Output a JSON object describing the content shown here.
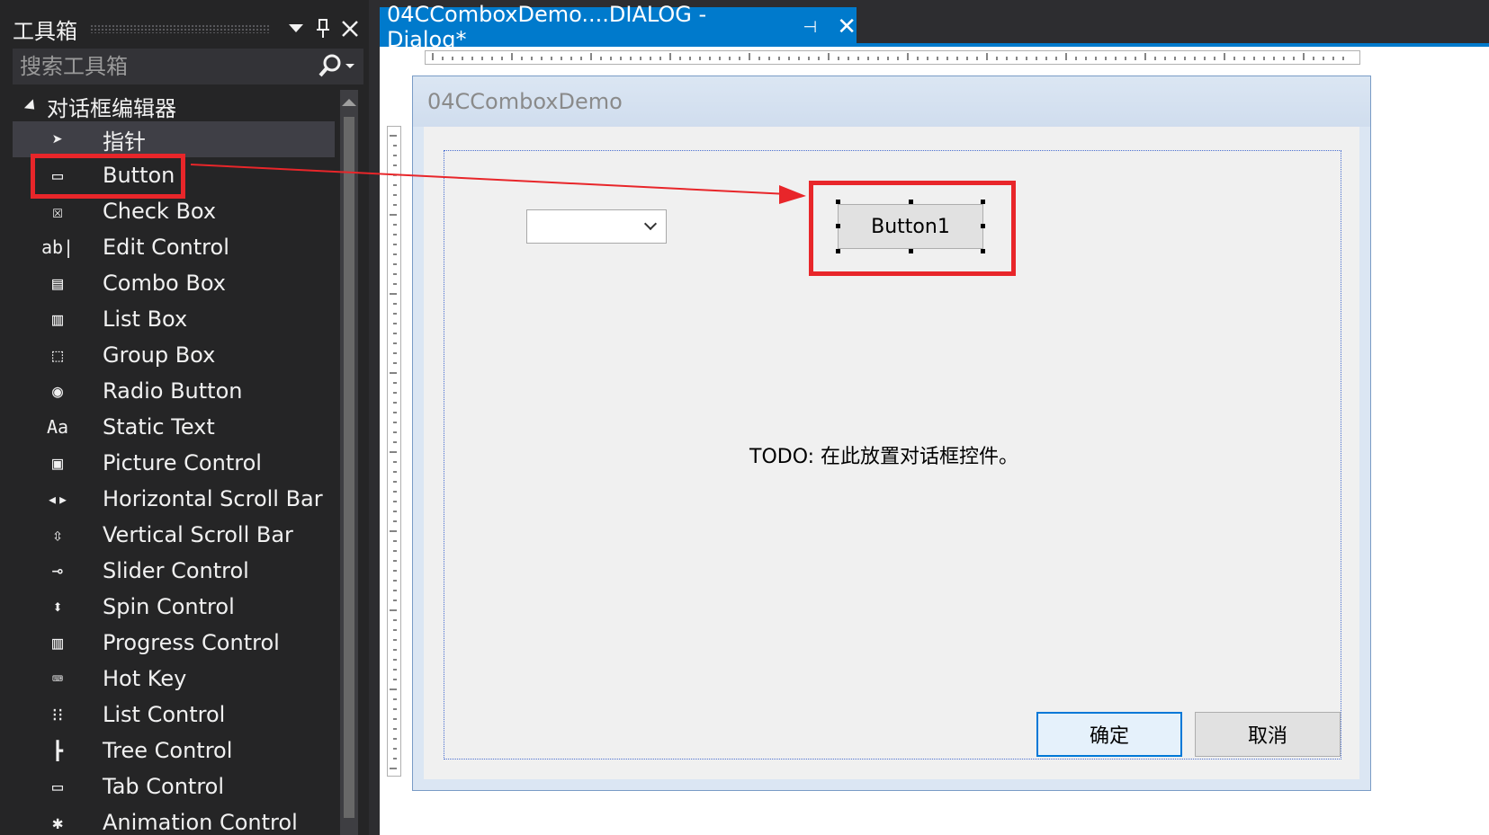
{
  "toolbox": {
    "title": "工具箱",
    "search_placeholder": "搜索工具箱",
    "category": "对话框编辑器",
    "items": [
      {
        "label": "指针",
        "icon": "pointer-icon",
        "glyph": "➤"
      },
      {
        "label": "Button",
        "icon": "button-icon",
        "glyph": "▭"
      },
      {
        "label": "Check Box",
        "icon": "checkbox-icon",
        "glyph": "☒"
      },
      {
        "label": "Edit Control",
        "icon": "edit-control-icon",
        "glyph": "ab|"
      },
      {
        "label": "Combo Box",
        "icon": "combo-box-icon",
        "glyph": "▤"
      },
      {
        "label": "List Box",
        "icon": "list-box-icon",
        "glyph": "▥"
      },
      {
        "label": "Group Box",
        "icon": "group-box-icon",
        "glyph": "⬚"
      },
      {
        "label": "Radio Button",
        "icon": "radio-button-icon",
        "glyph": "◉"
      },
      {
        "label": "Static Text",
        "icon": "static-text-icon",
        "glyph": "Aa"
      },
      {
        "label": "Picture Control",
        "icon": "picture-control-icon",
        "glyph": "▣"
      },
      {
        "label": "Horizontal Scroll Bar",
        "icon": "hscroll-icon",
        "glyph": "◂▸"
      },
      {
        "label": "Vertical Scroll Bar",
        "icon": "vscroll-icon",
        "glyph": "⇳"
      },
      {
        "label": "Slider Control",
        "icon": "slider-icon",
        "glyph": "⊸"
      },
      {
        "label": "Spin Control",
        "icon": "spin-icon",
        "glyph": "⬍"
      },
      {
        "label": "Progress Control",
        "icon": "progress-icon",
        "glyph": "▥"
      },
      {
        "label": "Hot Key",
        "icon": "hotkey-icon",
        "glyph": "⌨"
      },
      {
        "label": "List Control",
        "icon": "list-control-icon",
        "glyph": "⁝⁝"
      },
      {
        "label": "Tree Control",
        "icon": "tree-control-icon",
        "glyph": "┣"
      },
      {
        "label": "Tab Control",
        "icon": "tab-control-icon",
        "glyph": "▭"
      },
      {
        "label": "Animation Control",
        "icon": "animation-icon",
        "glyph": "✱"
      }
    ]
  },
  "doc_tab": {
    "title": "04CComboxDemo....DIALOG - Dialog*",
    "pin_glyph": "⊣",
    "close_glyph": "✕"
  },
  "dialog": {
    "title": "04CComboxDemo",
    "button1": "Button1",
    "todo": "TODO: 在此放置对话框控件。",
    "ok": "确定",
    "cancel": "取消"
  },
  "colors": {
    "accent": "#007acc",
    "highlight": "#e8262a"
  }
}
